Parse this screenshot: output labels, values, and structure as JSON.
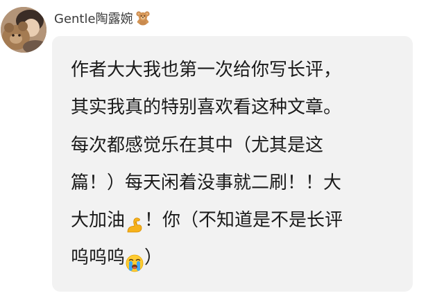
{
  "comment": {
    "username": "Gentle陶露婉",
    "username_badge_icon": "teddy-bear-emoji-icon",
    "lines": [
      "作者大大我也第一次给你写长评，",
      "其实我真的特别喜欢看这种文章。",
      "每次都感觉乐在其中（尤其是这",
      "篇！）每天闲着没事就二刷！！大"
    ],
    "line5_before_emoji": "大加油",
    "line5_emoji_icon": "flexed-biceps-emoji-icon",
    "line5_after_emoji": "！你（不知道是不是长评",
    "line6_before_emoji": "呜呜呜",
    "line6_emoji_icon": "loudly-crying-face-emoji-icon",
    "line6_after_emoji": "）"
  },
  "colors": {
    "bubble_background": "#f2f2f2",
    "text": "#1a1a1a",
    "username": "#3a3a3a"
  }
}
